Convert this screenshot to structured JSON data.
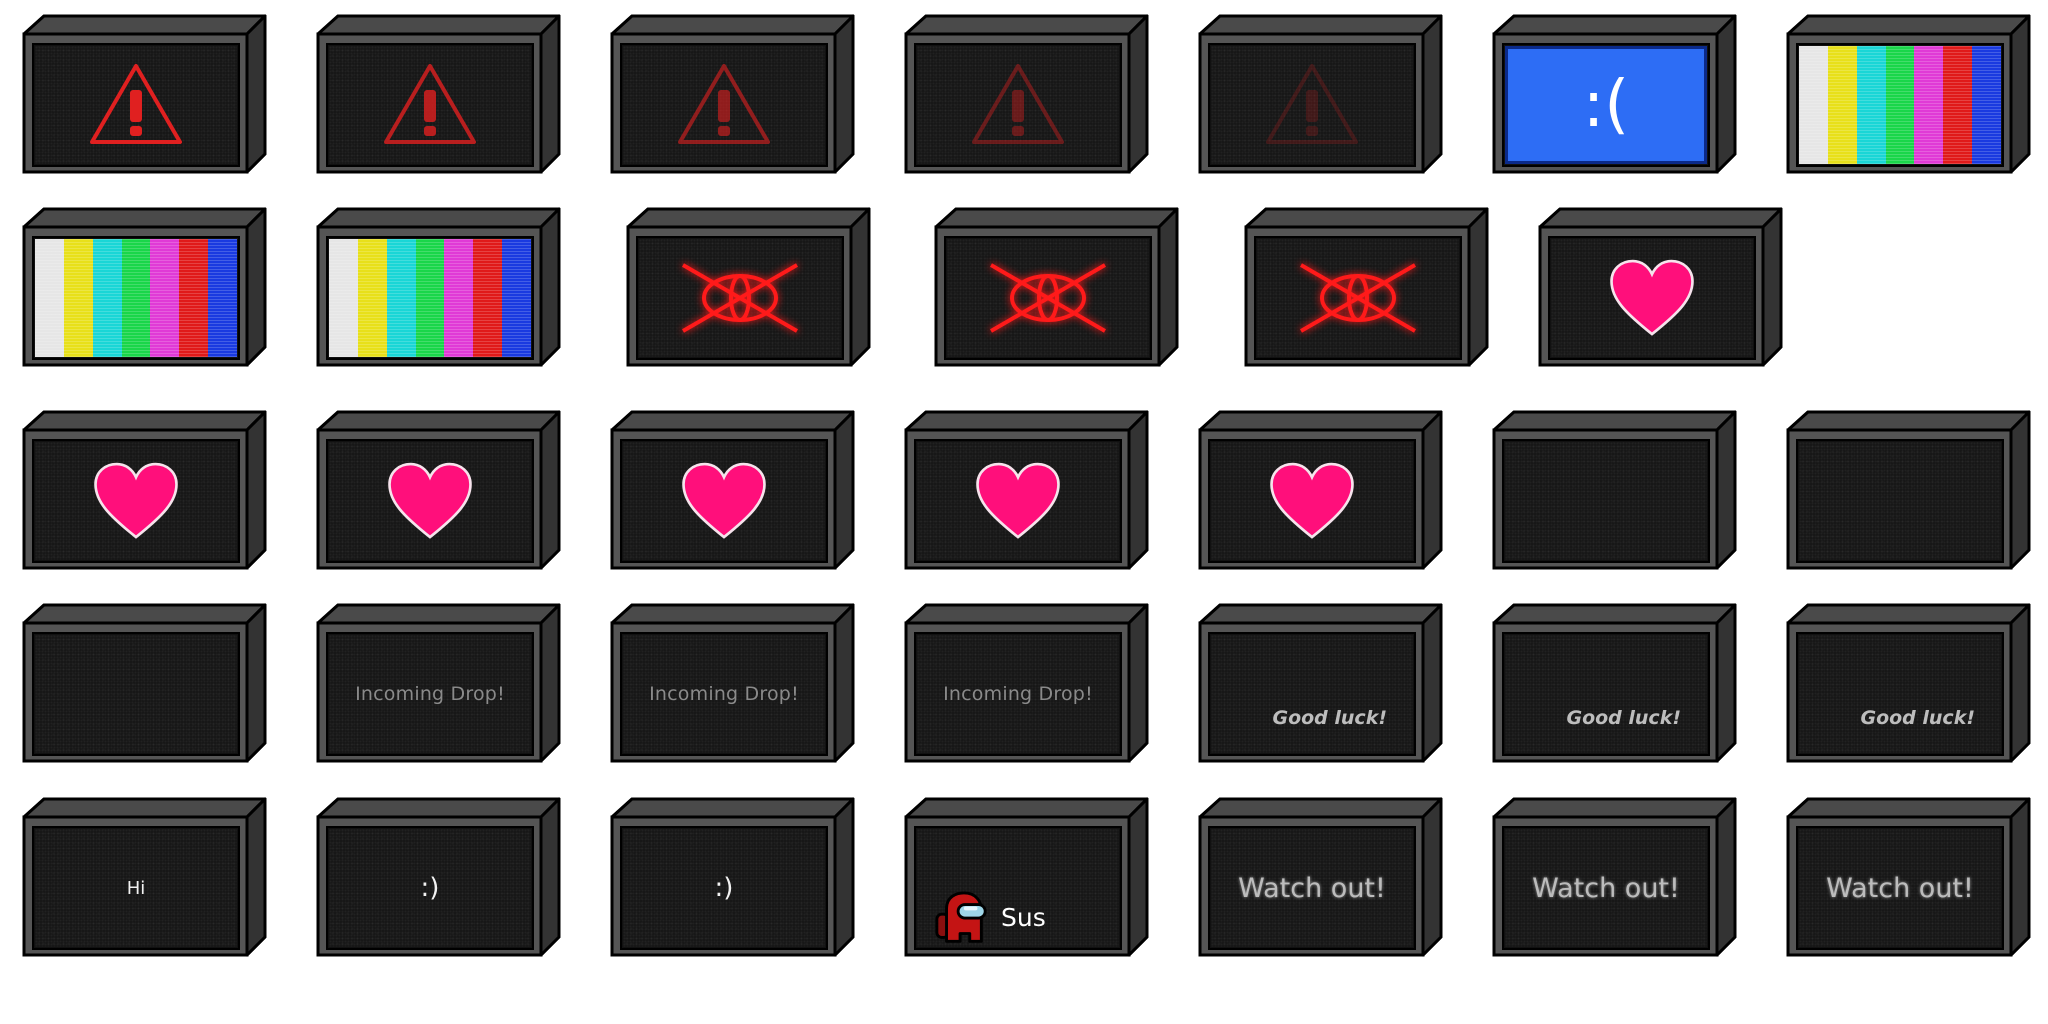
{
  "frames": [
    {
      "kind": "warning",
      "warn_opacity": 1.0
    },
    {
      "kind": "warning",
      "warn_opacity": 0.8
    },
    {
      "kind": "warning",
      "warn_opacity": 0.6
    },
    {
      "kind": "warning",
      "warn_opacity": 0.4
    },
    {
      "kind": "warning",
      "warn_opacity": 0.2
    },
    {
      "kind": "bluescreen",
      "text": ":("
    },
    {
      "kind": "colorbars"
    },
    {
      "kind": "colorbars"
    },
    {
      "kind": "colorbars"
    },
    {
      "kind": "eye"
    },
    {
      "kind": "eye"
    },
    {
      "kind": "eye"
    },
    {
      "kind": "heart"
    },
    {
      "kind": "heart"
    },
    {
      "kind": "heart"
    },
    {
      "kind": "heart"
    },
    {
      "kind": "heart"
    },
    {
      "kind": "heart"
    },
    {
      "kind": "blank"
    },
    {
      "kind": "blank"
    },
    {
      "kind": "blank"
    },
    {
      "kind": "drop",
      "text": "Incoming Drop!"
    },
    {
      "kind": "drop",
      "text": "Incoming Drop!"
    },
    {
      "kind": "drop",
      "text": "Incoming Drop!"
    },
    {
      "kind": "luck",
      "text": "Good luck!"
    },
    {
      "kind": "luck",
      "text": "Good luck!"
    },
    {
      "kind": "luck",
      "text": "Good luck!"
    },
    {
      "kind": "hi",
      "text": "Hi"
    },
    {
      "kind": "smile",
      "text": ":)"
    },
    {
      "kind": "smile",
      "text": ":)"
    },
    {
      "kind": "sus",
      "text": "Sus"
    },
    {
      "kind": "watch",
      "text": "Watch out!"
    },
    {
      "kind": "watch",
      "text": "Watch out!"
    },
    {
      "kind": "watch",
      "text": "Watch out!"
    }
  ],
  "colors": {
    "bars": [
      "#e6e6e6",
      "#e8e01a",
      "#1ad6d6",
      "#1ad64a",
      "#e03ad6",
      "#e01a1a",
      "#1a3ae0"
    ],
    "heart": "#ff0f7b",
    "warning": "#e02020",
    "eye": "#ff1a1a",
    "bluescreen": "#2d6df5",
    "crewmate": "#c41414"
  }
}
